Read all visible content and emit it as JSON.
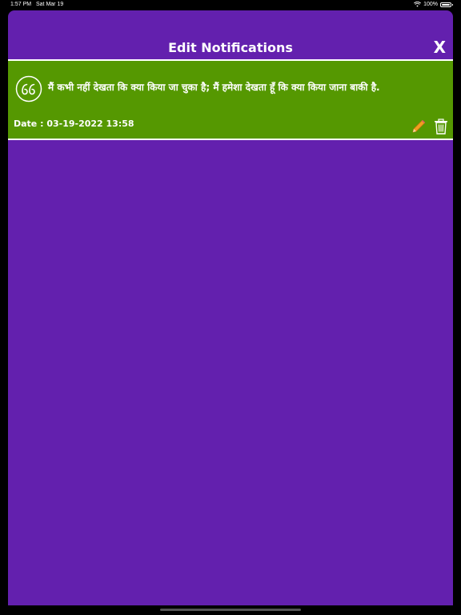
{
  "status_bar": {
    "time": "1:57 PM",
    "date": "Sat Mar 19",
    "battery": "100%"
  },
  "header": {
    "title": "Edit Notifications",
    "close_label": "X"
  },
  "note": {
    "text": "मैं कभी नहीं देखता कि क्या किया जा चुका है; मैं हमेशा देखता हूँ कि क्या किया जाना बाकी है.",
    "date": "Date : 03-19-2022 13:58"
  },
  "colors": {
    "background": "#6320ae",
    "card": "#559801",
    "pencil": "#f0a020"
  },
  "icons": {
    "quote": "quote-icon",
    "edit": "pencil-icon",
    "delete": "trash-icon",
    "wifi": "wifi-icon",
    "battery": "battery-icon"
  }
}
